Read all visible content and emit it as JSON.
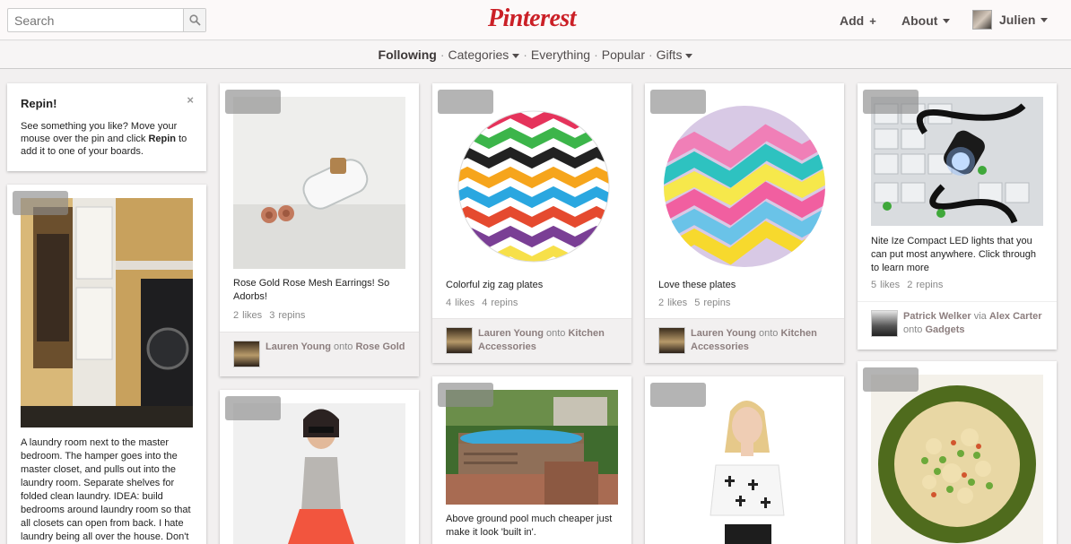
{
  "header": {
    "search_placeholder": "Search",
    "logo": "Pinterest",
    "add_label": "Add",
    "add_symbol": "+",
    "about_label": "About",
    "user_name": "Julien"
  },
  "subnav": {
    "items": [
      "Following",
      "Categories",
      "Everything",
      "Popular",
      "Gifts"
    ]
  },
  "repin_tip": {
    "title": "Repin!",
    "text_before": "See something you like? Move your mouse over the pin and click ",
    "text_bold": "Repin",
    "text_after": " to add it to one of your boards.",
    "close": "×"
  },
  "pins": [
    {
      "description": "A laundry room next to the master bedroom. The hamper goes into the master closet, and pulls out into the laundry room. Separate shelves for folded clean laundry. IDEA: build bedrooms around laundry room so that all closets can open from back. I hate laundry being all over the house. Don't"
    },
    {
      "description": "Rose Gold Rose Mesh Earrings! So Adorbs!",
      "likes": "2 likes",
      "repins": "3 repins",
      "user": "Lauren Young",
      "onto": "onto",
      "board": "Rose Gold"
    },
    {
      "description": "Colorful zig zag plates",
      "likes": "4 likes",
      "repins": "4 repins",
      "user": "Lauren Young",
      "onto": "onto",
      "board": "Kitchen Accessories"
    },
    {
      "description": "Love these plates",
      "likes": "2 likes",
      "repins": "5 repins",
      "user": "Lauren Young",
      "onto": "onto",
      "board": "Kitchen Accessories"
    },
    {
      "description": "Nite Ize Compact LED lights that you can put most anywhere. Click through to learn more",
      "likes": "5 likes",
      "repins": "2 repins",
      "user": "Patrick Welker",
      "via": "via",
      "via_user": "Alex Carter",
      "onto": "onto",
      "board": "Gadgets"
    },
    {
      "description": "Above ground pool much cheaper just make it look 'built in'."
    }
  ],
  "colors": {
    "brand_red": "#cb2027",
    "background": "#f2f0f0"
  }
}
